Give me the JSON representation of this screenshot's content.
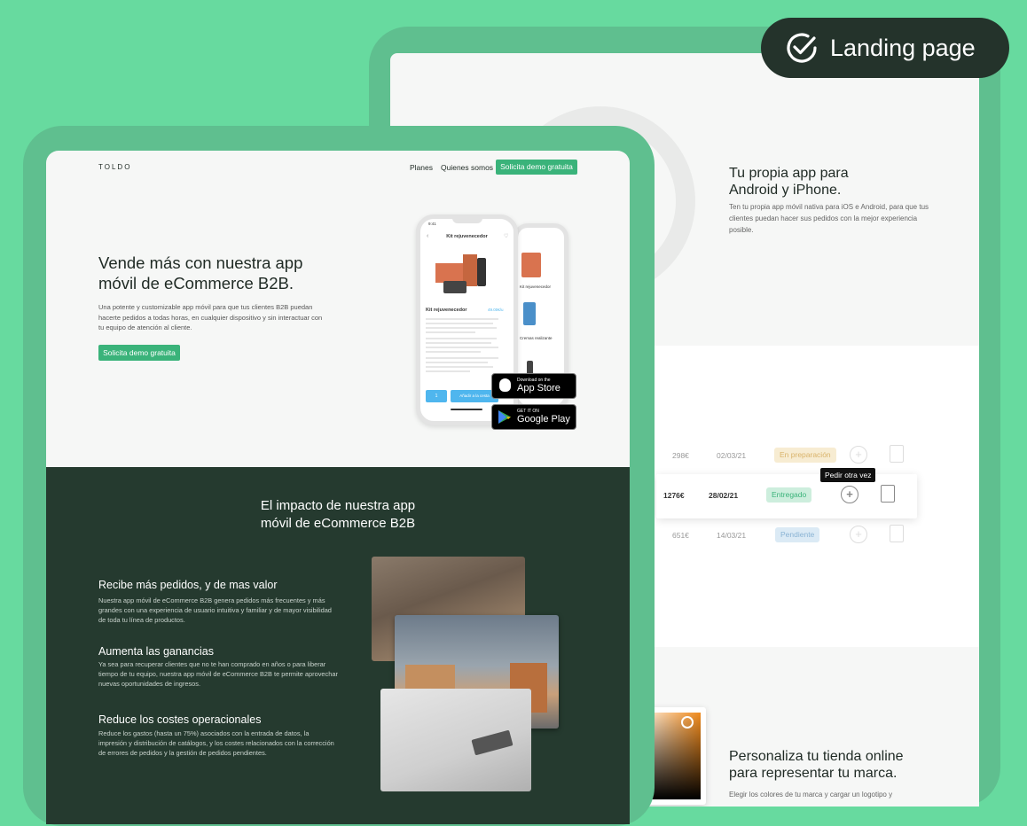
{
  "badge": {
    "label": "Landing page",
    "icon": "check-circle-icon"
  },
  "back": {
    "app_title_line1": "Tu propia app para",
    "app_title_line2": "Android y iPhone.",
    "app_desc": "Ten tu propia app móvil nativa para iOS e Android, para que tus clientes puedan hacer sus pedidos con la mejor experiencia posible.",
    "orders": [
      {
        "amount": "298€",
        "date": "02/03/21",
        "status": "En preparación"
      },
      {
        "amount": "1276€",
        "date": "28/02/21",
        "status": "Entregado"
      },
      {
        "amount": "651€",
        "date": "14/03/21",
        "status": "Pendiente"
      }
    ],
    "tooltip": "Pedir otra vez",
    "brand_title_line1": "Personaliza tu tienda online",
    "brand_title_line2": "para representar tu marca.",
    "brand_desc": "Elegir los colores de tu marca y cargar un logotipo y"
  },
  "front": {
    "logo": "TOLDO",
    "nav": {
      "plans": "Planes",
      "about": "Quienes somos",
      "cta": "Solicita demo gratuita"
    },
    "hero": {
      "title_line1": "Vende más con nuestra app",
      "title_line2": "móvil de eCommerce B2B.",
      "desc": "Una potente y customizable app móvil para que tus clientes B2B puedan hacerte pedidos a todas horas, en cualquier dispositivo y sin interactuar con tu equipo de atención al cliente.",
      "cta": "Solicita demo gratuita"
    },
    "phone": {
      "time": "9:41",
      "header": "Kit rejuvenecedor",
      "product": "Kit rejuvenecedor",
      "price": "49.00€/u",
      "qty": "1",
      "add_btn": "Añadir a la cesta",
      "side_item1": "Kit rejuvenecedor",
      "side_item2": "Cremas realizante"
    },
    "stores": {
      "apple_small": "Download on the",
      "apple_big": "App Store",
      "google_small": "GET IT ON",
      "google_big": "Google Play"
    },
    "impact": {
      "title_line1": "El impacto de nuestra app",
      "title_line2": "móvil de eCommerce B2B",
      "features": [
        {
          "title": "Recibe más pedidos, y de mas valor",
          "desc": "Nuestra app móvil de eCommerce B2B genera pedidos más frecuentes y más grandes con una experiencia de usuario intuitiva y familiar y de mayor visibilidad de toda tu línea de productos."
        },
        {
          "title": "Aumenta las ganancias",
          "desc": "Ya sea para recuperar clientes que no te han comprado en años o para liberar tiempo de tu equipo, nuestra app móvil de eCommerce B2B te permite aprovechar nuevas oportunidades de ingresos."
        },
        {
          "title": "Reduce los costes operacionales",
          "desc": "Reduce los gastos (hasta un 75%) asociados con la entrada de datos, la impresión y distribución de catálogos, y los costes relacionados con la corrección de errores de pedidos y la gestión de pedidos pendientes."
        }
      ]
    }
  },
  "colors": {
    "brand_green": "#3ab37a",
    "dark_green": "#253a2f",
    "bg_green": "#67da9f",
    "blue": "#4fb6ee"
  }
}
